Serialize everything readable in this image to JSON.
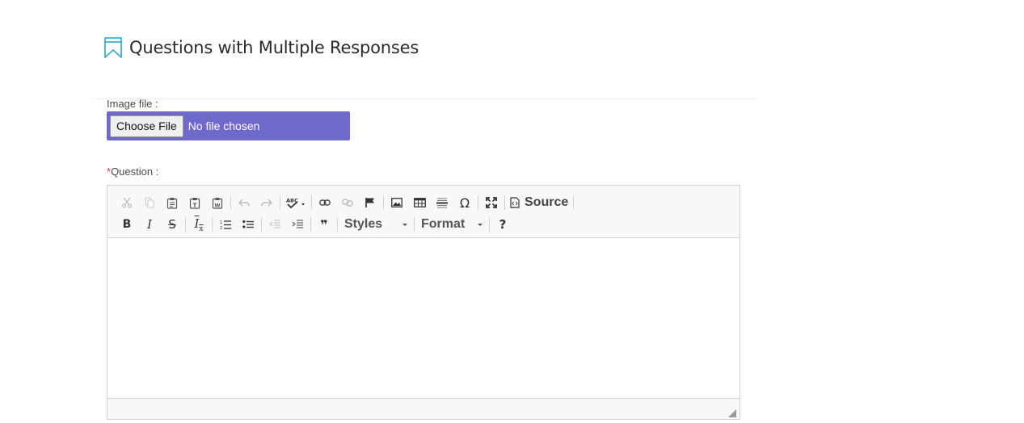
{
  "header": {
    "title": "Questions with Multiple Responses",
    "icon": "bookmark-icon"
  },
  "form": {
    "image_field": {
      "label": "Image file :",
      "button_label": "Choose File",
      "status": "No file chosen"
    },
    "question_field": {
      "required_mark": "*",
      "label": "Question :"
    }
  },
  "editor": {
    "toolbar_row1": [
      {
        "icon": "cut-icon",
        "enabled": false
      },
      {
        "icon": "copy-icon",
        "enabled": false
      },
      {
        "icon": "paste-icon",
        "enabled": true
      },
      {
        "icon": "paste-text-icon",
        "enabled": true
      },
      {
        "icon": "paste-word-icon",
        "enabled": true
      },
      {
        "icon": "undo-icon",
        "enabled": false
      },
      {
        "icon": "redo-icon",
        "enabled": false
      },
      {
        "icon": "spellcheck-icon",
        "enabled": true
      },
      {
        "icon": "link-icon",
        "enabled": true
      },
      {
        "icon": "unlink-icon",
        "enabled": false
      },
      {
        "icon": "anchor-flag-icon",
        "enabled": true
      },
      {
        "icon": "image-icon",
        "enabled": true
      },
      {
        "icon": "table-icon",
        "enabled": true
      },
      {
        "icon": "horizontal-line-icon",
        "enabled": true
      },
      {
        "icon": "special-char-icon",
        "enabled": true
      },
      {
        "icon": "maximize-icon",
        "enabled": true
      },
      {
        "icon": "source-icon",
        "enabled": true
      }
    ],
    "source_label": "Source",
    "special_char_glyph": "Ω",
    "bold_glyph": "B",
    "italic_glyph": "I",
    "strike_glyph": "S",
    "remove_format_glyph": "I",
    "remove_format_sub": "x",
    "blockquote_glyph": "❞",
    "help_glyph": "?",
    "styles_label": "Styles",
    "format_label": "Format",
    "colors": {
      "toolbar_bg": "#f8f8f8",
      "border": "#d1d1d1",
      "file_box": "#7069cc",
      "title_icon": "#3aaed8",
      "required": "#d63b3b"
    }
  }
}
